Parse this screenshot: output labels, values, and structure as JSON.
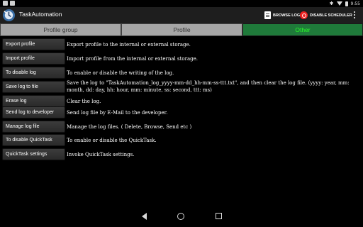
{
  "status_bar": {
    "time": "9:55",
    "icons": [
      "android-icon",
      "image-icon",
      "bluetooth-icon",
      "wifi-icon",
      "battery-icon"
    ]
  },
  "action_bar": {
    "app_title": "TaskAutomation",
    "browse_log_label": "BROWSE LOG",
    "disable_scheduler_label": "DISABLE SCHEDULER"
  },
  "tabs": [
    {
      "label": "Profile group"
    },
    {
      "label": "Profile"
    },
    {
      "label": "Other",
      "selected": true
    }
  ],
  "rows": [
    {
      "button": "Export profile",
      "description": "Export profile to the internal or external storage."
    },
    {
      "button": "Import profile",
      "description": "Import profile from the internal or external storage."
    },
    {
      "button": "To disable log",
      "description": "To enable or disable the writing of the log."
    },
    {
      "button": "Save log to file",
      "description": "Save the log to \"TaskAutomation_log_yyyy-mm-dd_hh-mm-ss-ttt.txt\", and then clear the log file. (yyyy: year, mm: month, dd: day, hh: hour, mm: minute, ss: second, ttt: ms)"
    },
    {
      "button": "Erase log",
      "description": "Clear the log."
    },
    {
      "button": "Send log to developer",
      "description": "Send log file by E-Mail to the developer."
    },
    {
      "button": "Manage log file",
      "description": "Manage the log files. ( Delete, Browse, Send etc )"
    },
    {
      "button": "To disable QuickTask",
      "description": "To enable or disable the QuickTask."
    },
    {
      "button": "QuickTask settings",
      "description": "Invoke QuickTask settings."
    }
  ],
  "colors": {
    "action_bar_bg": "#1e1e1e",
    "tab_bg": "#a6a6a6",
    "tab_selected_bg": "#1f7a3a",
    "tab_selected_text": "#29ff29",
    "power_icon": "#e22222"
  }
}
